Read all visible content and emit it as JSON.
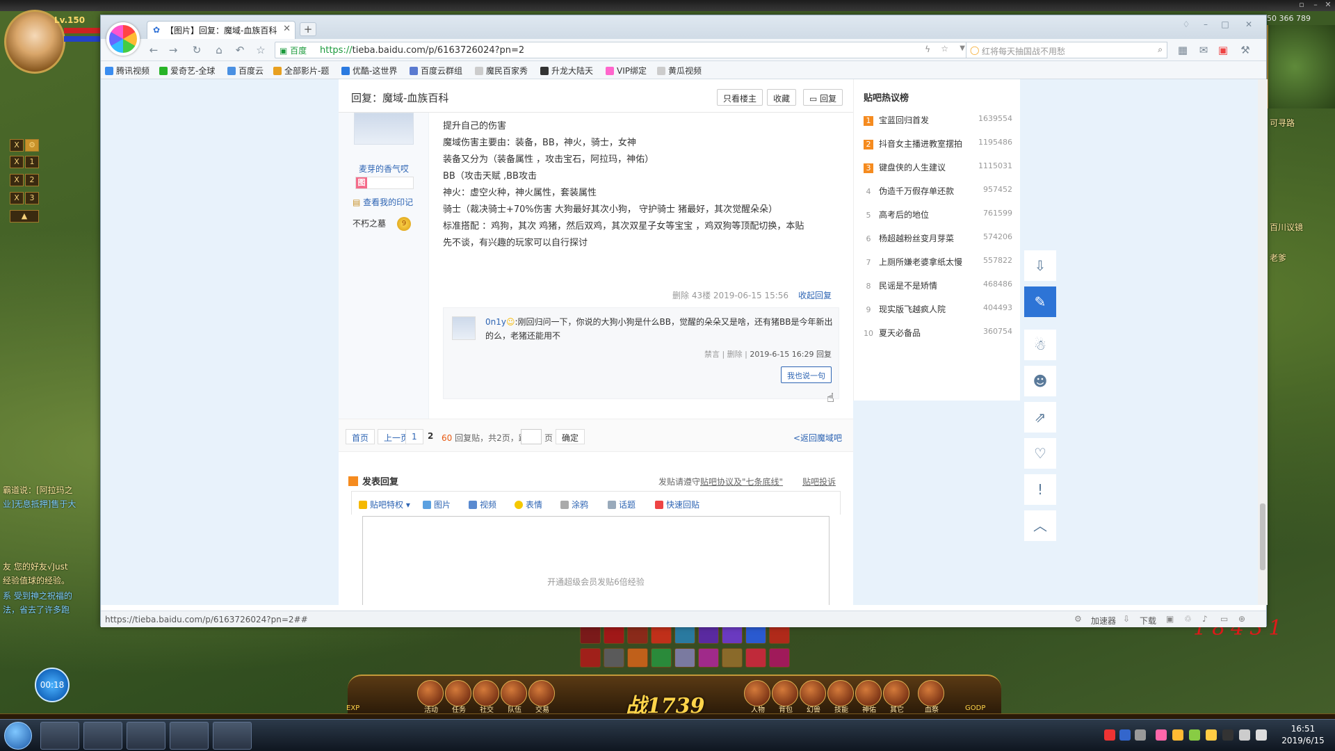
{
  "game": {
    "level": "Lv.150",
    "coords": "366  789",
    "map_id": "50",
    "timer": "00:18",
    "power_label": "战",
    "power_value": "1739",
    "red_numbers": "18431",
    "chat_lines": [
      "霸道说：[阿拉玛之",
      "业]无息抵押]售于大",
      "友 您的好友√Just",
      "经验值球的经验。",
      "系 受到神之祝福的",
      "法，省去了许多跑"
    ],
    "right_labels": [
      "可寻路",
      "百川议镜",
      "老爹"
    ],
    "hud_slots": [
      "X",
      "1",
      "X",
      "2",
      "X",
      "3"
    ],
    "menu_buttons": [
      "活动",
      "任务",
      "社交",
      "队伍",
      "交易",
      "人物",
      "背包",
      "幻兽",
      "技能",
      "神佑",
      "其它",
      "血祭"
    ],
    "exp_label": "EXP",
    "godp_label": "GODP"
  },
  "browser": {
    "tab_title": "【图片】回复：魔域-血族百科",
    "url_protocol": "https://",
    "url_rest": "tieba.baidu.com/p/6163726024?pn=2",
    "secure_label": "百度",
    "search_placeholder": "红将每天抽国战不用愁",
    "bookmarks": [
      "腾讯视频",
      "爱奇艺-全球",
      "百度云",
      "全部影片-题",
      "优酷-这世界",
      "百度云群组",
      "魔民百家秀",
      "升龙大陆天",
      "VIP绑定",
      "黄瓜视频"
    ],
    "status_url": "https://tieba.baidu.com/p/6163726024?pn=2##",
    "status_right": [
      "加速器",
      "下载"
    ]
  },
  "post": {
    "title": "回复：魔域-血族百科",
    "header_buttons": [
      "只看楼主",
      "收藏",
      "回复"
    ],
    "author": "麦芽的香气哎",
    "level_icon": "图",
    "imprint": "查看我的印记",
    "medal_name": "不朽之墓",
    "medal_level": "9",
    "lines": [
      "提升自己的伤害",
      "魔域伤害主要由：装备，BB，神火，骑士，女神",
      "装备又分为（装备属性 ，攻击宝石，阿拉玛，神佑）",
      "BB（攻击天赋 ,BB攻击",
      "神火：虚空火种，神火属性，套装属性",
      "骑士（裁决骑士+70%伤害 大狗最好其次小狗， 守护骑士 猪最好，其次觉醒朵朵）",
      "标准搭配 ：鸡狗，其次 鸡猪，然后双鸡，其次双星子女等宝宝 ，鸡双狗等顶配切换，本贴",
      "先不谈，有兴趣的玩家可以自行探讨"
    ],
    "meta": "删除  43楼  2019-06-15 15:56",
    "fold_label": "收起回复",
    "lzl_user": "0n1y",
    "lzl_text": ":刚回归问一下，你说的大狗小狗是什么BB，觉醒的朵朵又是啥，还有猪BB是今年新出的么，老猪还能用不",
    "lzl_meta_a": "禁言 | 删除 | ",
    "lzl_meta_b": "2019-6-15 16:29 回复",
    "say_btn": "我也说一句"
  },
  "pager": {
    "first": "首页",
    "prev": "上一页",
    "p1": "1",
    "p2": "2",
    "count": "60",
    "info": "回复贴，共2页，跳到",
    "page_unit": "页",
    "confirm": "确定",
    "back": "<返回魔域吧"
  },
  "reply": {
    "title": "发表回复",
    "notice_a": "发贴请遵守",
    "notice_link": "贴吧协议及\"七条底线\"",
    "complain": "贴吧投诉",
    "tools": [
      "贴吧特权",
      "图片",
      "视频",
      "表情",
      "涂鸦",
      "话题",
      "快速回贴"
    ],
    "hint": "开通超级会员发贴6倍经验"
  },
  "hot": {
    "title": "贴吧热议榜",
    "items": [
      {
        "rank": "1",
        "name": "宝蓝回归首发",
        "count": "1639554"
      },
      {
        "rank": "2",
        "name": "抖音女主播进教室摆拍",
        "count": "1195486"
      },
      {
        "rank": "3",
        "name": "键盘侠的人生建议",
        "count": "1115031"
      },
      {
        "rank": "4",
        "name": "伪造千万假存单还款",
        "count": "957452"
      },
      {
        "rank": "5",
        "name": "高考后的地位",
        "count": "761599"
      },
      {
        "rank": "6",
        "name": "杨超越粉丝变月芽菜",
        "count": "574206"
      },
      {
        "rank": "7",
        "name": "上厕所嫌老婆拿纸太慢",
        "count": "557822"
      },
      {
        "rank": "8",
        "name": "民谣是不是矫情",
        "count": "468486"
      },
      {
        "rank": "9",
        "name": "现实版飞越疯人院",
        "count": "404493"
      },
      {
        "rank": "10",
        "name": "夏天必备品",
        "count": "360754"
      }
    ]
  },
  "taskbar": {
    "time": "16:51",
    "date": "2019/6/15"
  },
  "colors": {
    "link": "#2d64b3",
    "accent": "#2d74d6",
    "rank_top": "#f58b1f",
    "count_orange": "#e85a12"
  }
}
